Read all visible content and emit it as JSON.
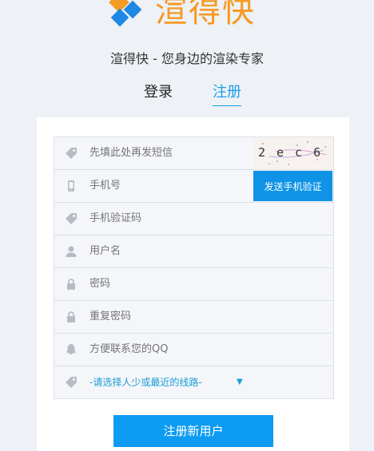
{
  "brand": {
    "name": "渲得快",
    "tagline": "渲得快 - 您身边的渲染专家"
  },
  "tabs": [
    {
      "label": "登录"
    },
    {
      "label": "注册",
      "active": true
    }
  ],
  "form": {
    "captcha_field": {
      "placeholder": "先填此处再发短信",
      "captcha_text": "2ec6"
    },
    "phone_field": {
      "placeholder": "手机号",
      "send_button": "发送手机验证"
    },
    "sms_code_field": {
      "placeholder": "手机验证码"
    },
    "username_field": {
      "placeholder": "用户名"
    },
    "password_field": {
      "placeholder": "密码"
    },
    "confirm_password_field": {
      "placeholder": "重复密码"
    },
    "qq_field": {
      "placeholder": "方便联系您的QQ"
    },
    "route_select": {
      "value": "-请选择人少或最近的线路-"
    }
  },
  "submit_label": "注册新用户",
  "colors": {
    "accent": "#0e9bf2",
    "brand_orange": "#f59a23",
    "tab_active": "#19a0e8"
  }
}
